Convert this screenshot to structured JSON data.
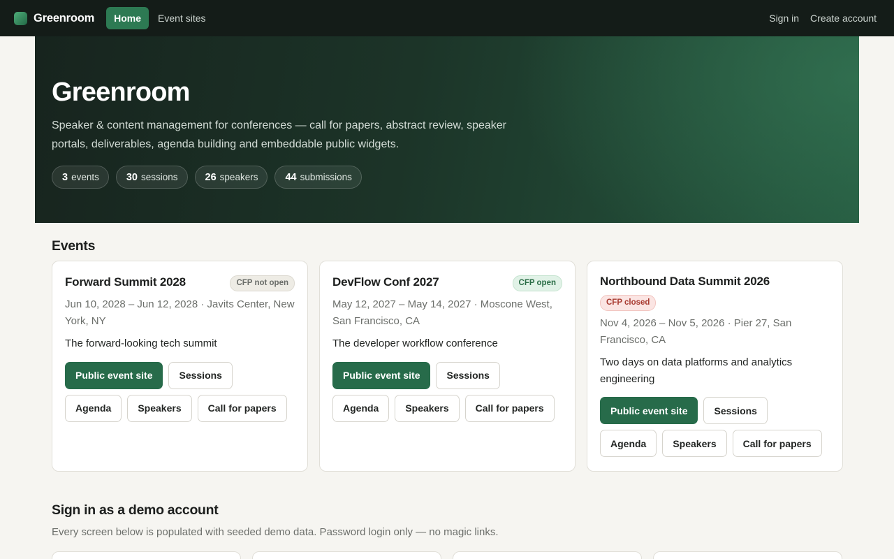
{
  "nav": {
    "brand": "Greenroom",
    "links": [
      "Home",
      "Event sites"
    ],
    "sign_in": "Sign in",
    "create_account": "Create account",
    "logo_icon": "greenroom-logo-icon"
  },
  "hero": {
    "title": "Greenroom",
    "description": "Speaker & content management for conferences — call for papers, abstract review, speaker portals, deliverables, agenda building and embeddable public widgets.",
    "stats": [
      {
        "value": "3",
        "label": "events"
      },
      {
        "value": "30",
        "label": "sessions"
      },
      {
        "value": "26",
        "label": "speakers"
      },
      {
        "value": "44",
        "label": "submissions"
      }
    ]
  },
  "events": {
    "heading": "Events",
    "items": [
      {
        "title": "Forward Summit 2028",
        "badge": "CFP not open",
        "meta": "Jun 10, 2028 – Jun 12, 2028 · Javits Center, New York, NY",
        "description": "The forward-looking tech summit"
      },
      {
        "title": "DevFlow Conf 2027",
        "badge": "CFP open",
        "meta": "May 12, 2027 – May 14, 2027 · Moscone West, San Francisco, CA",
        "description": "The developer workflow conference"
      },
      {
        "title": "Northbound Data Summit 2026",
        "badge": "CFP closed",
        "meta": "Nov 4, 2026 – Nov 5, 2026 · Pier 27, San Francisco, CA",
        "description": "Two days on data platforms and analytics engineering"
      }
    ],
    "buttons": {
      "public_site": "Public event site",
      "sessions": "Sessions",
      "agenda": "Agenda",
      "speakers": "Speakers",
      "cfp": "Call for papers"
    }
  },
  "demo": {
    "heading": "Sign in as a demo account",
    "description": "Every screen below is populated with seeded demo data. Password login only — no magic links."
  },
  "colors": {
    "accent": "#276b4a",
    "nav_bg": "#141c18",
    "badge_open": "#2a6d46",
    "badge_closed": "#a83a30"
  }
}
